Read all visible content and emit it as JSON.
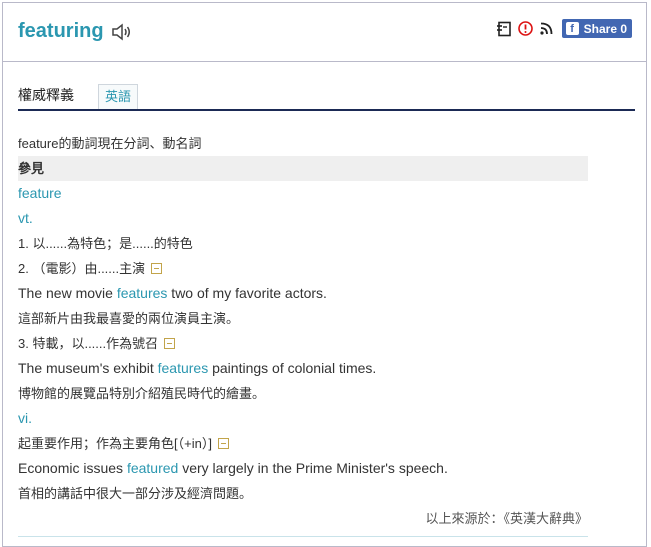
{
  "header": {
    "word": "featuring",
    "share_label": "Share 0",
    "icons": [
      "speaker-icon",
      "wordbook-icon",
      "report-icon",
      "rss-icon",
      "facebook-icon"
    ]
  },
  "tabs": {
    "main": "權威釋義",
    "english": "英語"
  },
  "entry": {
    "intro": "feature的動詞現在分詞、動名詞",
    "see_also": "參見",
    "headword": "feature",
    "pos_vt": "vt.",
    "sense1": "1. 以......為特色；是......的特色",
    "sense2": "2. （電影）由......主演",
    "ex2_pre": "The new movie ",
    "ex2_hl": "features",
    "ex2_post": " two of my favorite actors.",
    "ex2_zh": "這部新片由我最喜愛的兩位演員主演。",
    "sense3": "3. 特載，以......作為號召",
    "ex3_pre": "The museum's exhibit ",
    "ex3_hl": "features",
    "ex3_post": " paintings of colonial times.",
    "ex3_zh": "博物館的展覽品特別介紹殖民時代的繪畫。",
    "pos_vi": "vi.",
    "sense4": "起重要作用；作為主要角色[（+in）]",
    "ex4_pre": "Economic issues ",
    "ex4_hl": "featured",
    "ex4_post": " very largely in the Prime Minister's speech.",
    "ex4_zh": "首相的講話中很大一部分涉及經濟問題。",
    "source": "以上來源於：《英漢大辭典》"
  }
}
